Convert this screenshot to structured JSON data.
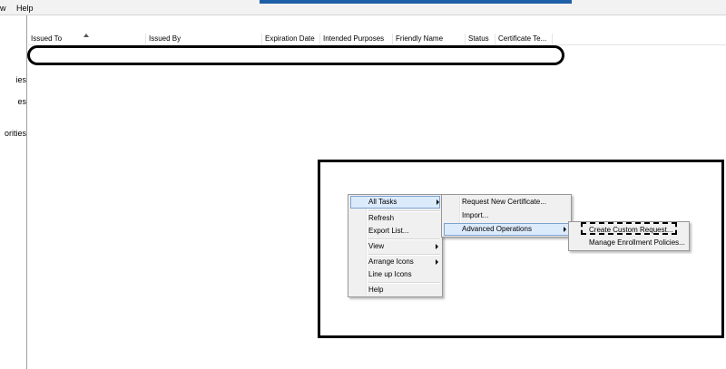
{
  "menubar": {
    "items": [
      "w",
      "Help"
    ]
  },
  "tree": {
    "items": [
      "ies",
      "es",
      "orities"
    ]
  },
  "columns": [
    "Issued To",
    "Issued By",
    "Expiration Date",
    "Intended Purposes",
    "Friendly Name",
    "Status",
    "Certificate Te..."
  ],
  "context_menu": {
    "items": [
      "All Tasks",
      "Refresh",
      "Export List...",
      "View",
      "Arrange Icons",
      "Line up Icons",
      "Help"
    ]
  },
  "all_tasks_submenu": {
    "items": [
      "Request New Certificate...",
      "Import...",
      "Advanced Operations"
    ]
  },
  "advanced_submenu": {
    "items": [
      "Create Custom Request...",
      "Manage Enrollment Policies..."
    ]
  },
  "colors": {
    "highlight_fill": "#dcebfc",
    "highlight_border": "#7da2ce",
    "title_accent": "#1f5fa8",
    "menu_bg": "#f0f0f0"
  }
}
